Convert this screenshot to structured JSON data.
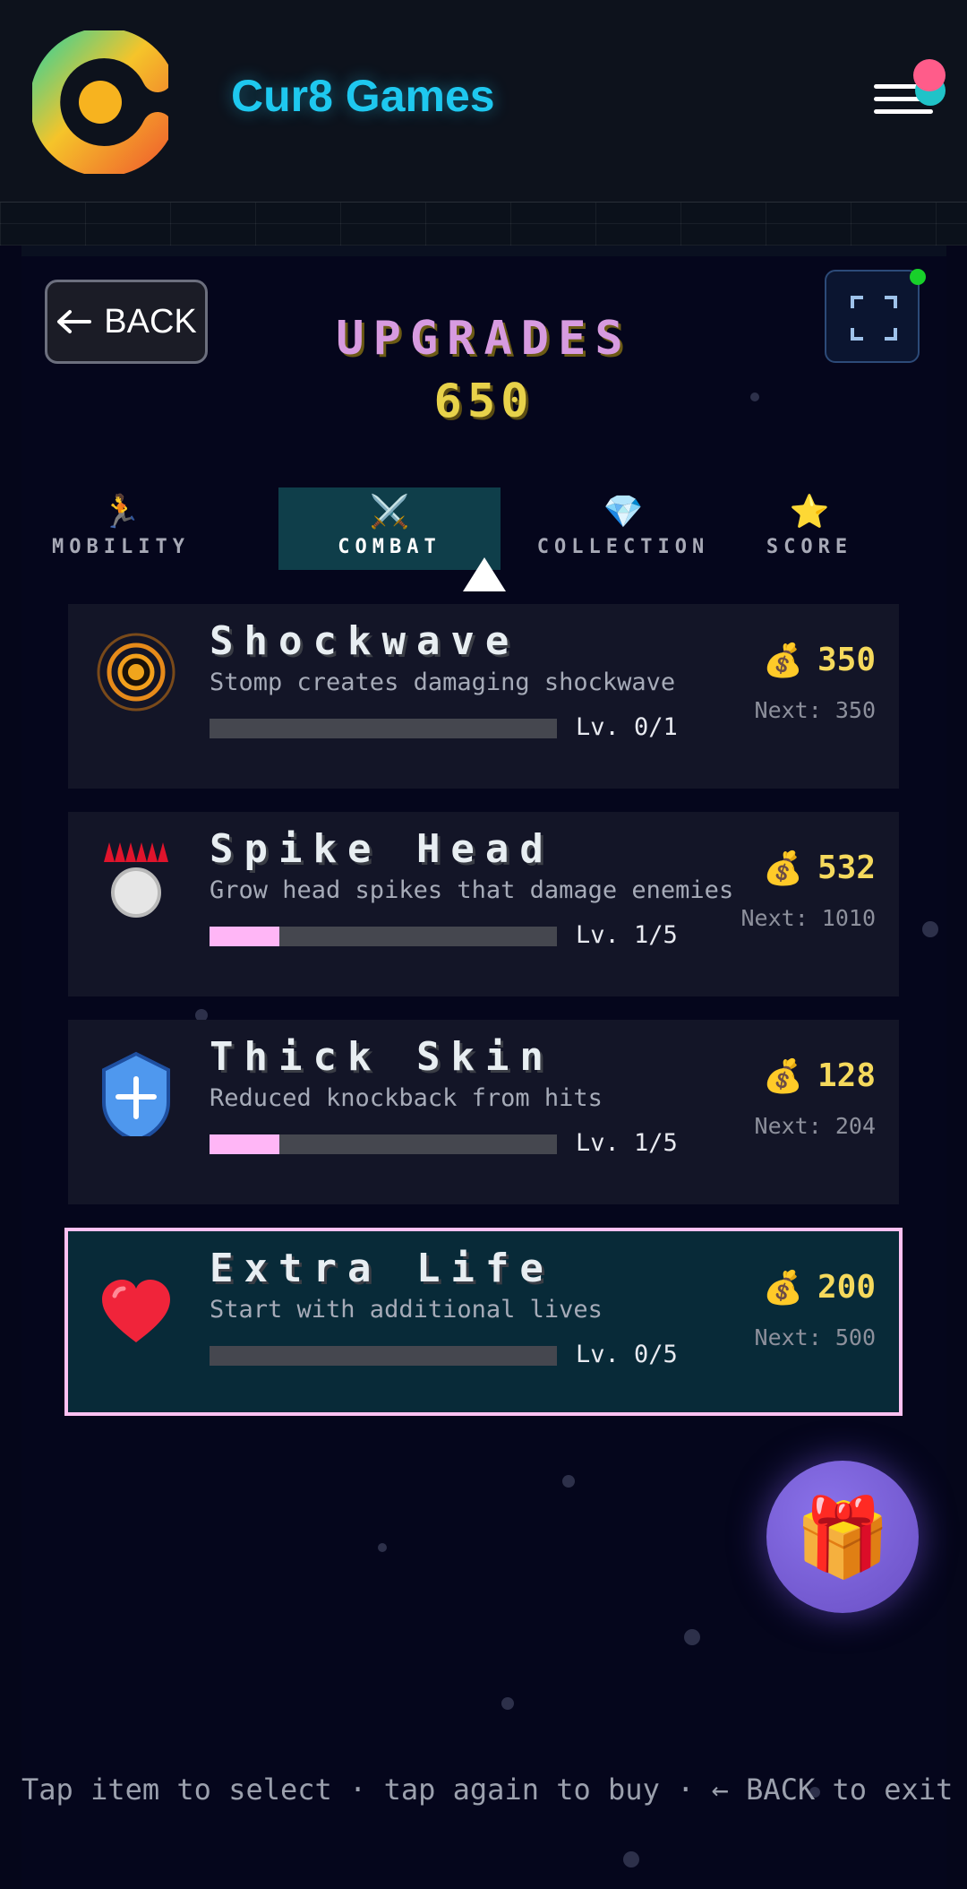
{
  "header": {
    "brand": "Cur8 Games",
    "logo_icon": "cur8-logo-icon",
    "menu_icon": "hamburger-menu-icon"
  },
  "game": {
    "back_label": "BACK",
    "back_icon": "arrow-left-icon",
    "fullscreen_icon": "fullscreen-icon",
    "title": "UPGRADES",
    "coins": "650",
    "tabs": [
      {
        "label": "MOBILITY",
        "icon": "🏃",
        "active": false
      },
      {
        "label": "COMBAT",
        "icon": "⚔️",
        "active": true
      },
      {
        "label": "COLLECTION",
        "icon": "💎",
        "active": false
      },
      {
        "label": "SCORE",
        "icon": "⭐",
        "active": false
      }
    ],
    "upgrades": [
      {
        "name": "Shockwave",
        "description": "Stomp creates damaging shockwave",
        "level": "Lv. 0/1",
        "progress": 0,
        "price": "350",
        "next": "Next: 350",
        "icon": "shockwave-icon",
        "selected": false
      },
      {
        "name": "Spike Head",
        "description": "Grow head spikes that damage enemies",
        "level": "Lv. 1/5",
        "progress": 0.2,
        "price": "532",
        "next": "Next: 1010",
        "icon": "spike-head-icon",
        "selected": false
      },
      {
        "name": "Thick Skin",
        "description": "Reduced knockback from hits",
        "level": "Lv. 1/5",
        "progress": 0.2,
        "price": "128",
        "next": "Next: 204",
        "icon": "shield-icon",
        "selected": false
      },
      {
        "name": "Extra Life",
        "description": "Start with additional lives",
        "level": "Lv. 0/5",
        "progress": 0,
        "price": "200",
        "next": "Next: 500",
        "icon": "heart-icon",
        "selected": true
      }
    ],
    "price_icon": "💰",
    "gift_icon": "🎁",
    "hint": "Tap item to select · tap again to buy · ← BACK to exit"
  },
  "colors": {
    "brand": "#1ec8ef",
    "title": "#d79be0",
    "coins": "#e8d24a",
    "progress": "#ffb6f6",
    "selected_border": "#ffc1f2"
  }
}
